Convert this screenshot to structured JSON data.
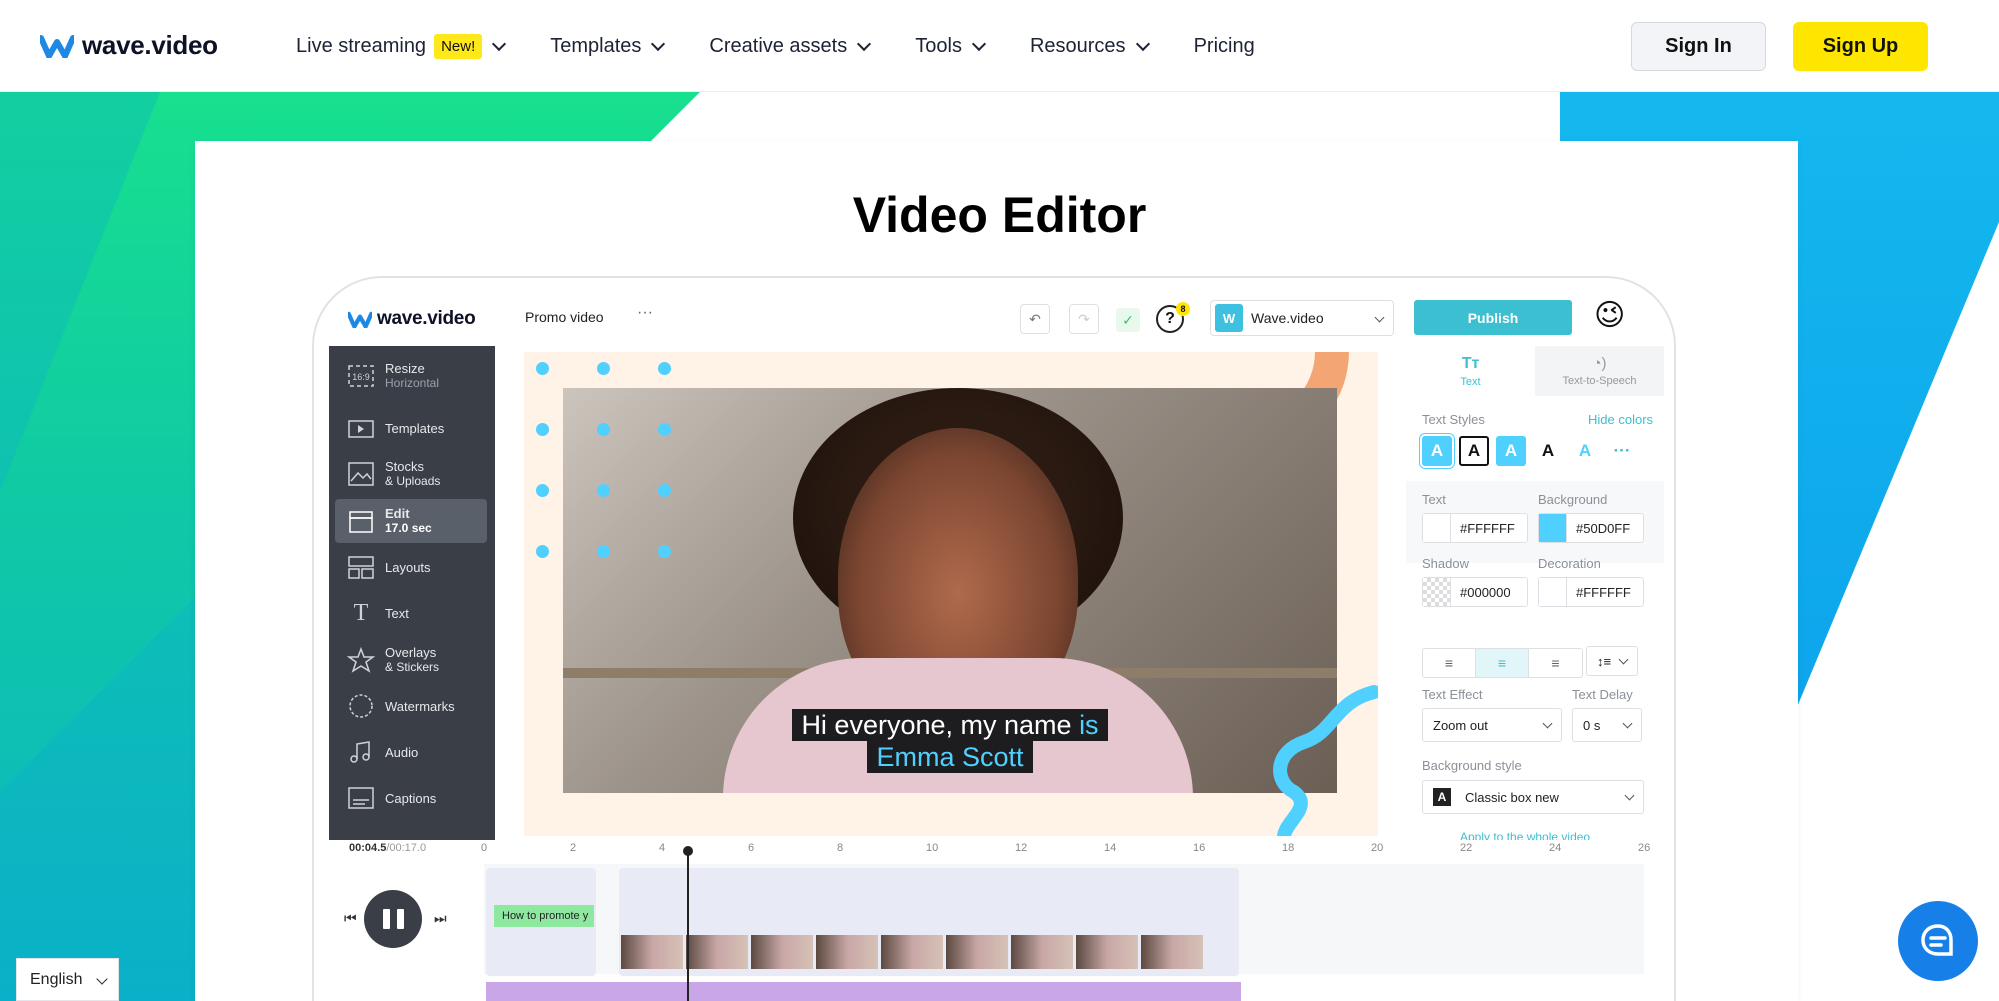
{
  "nav": {
    "brand": "wave.video",
    "items": [
      {
        "label": "Live streaming",
        "badge": "New!"
      },
      {
        "label": "Templates"
      },
      {
        "label": "Creative assets"
      },
      {
        "label": "Tools"
      },
      {
        "label": "Resources"
      },
      {
        "label": "Pricing"
      }
    ],
    "sign_in": "Sign In",
    "sign_up": "Sign Up"
  },
  "page": {
    "title": "Video Editor"
  },
  "app": {
    "brand": "wave.video",
    "project": "Promo video",
    "more": "···",
    "help_count": "8",
    "workspace": {
      "initial": "W",
      "name": "Wave.video"
    },
    "publish": "Publish",
    "sidebar": [
      {
        "icon": "16:9",
        "label": "Resize",
        "sub": "Horizontal"
      },
      {
        "icon": "templates-icon",
        "label": "Templates",
        "sub": ""
      },
      {
        "icon": "image-icon",
        "label": "Stocks",
        "sub": "& Uploads"
      },
      {
        "icon": "clapper-icon",
        "label": "Edit",
        "sub": "17.0 sec"
      },
      {
        "icon": "layouts-icon",
        "label": "Layouts",
        "sub": ""
      },
      {
        "icon": "T",
        "label": "Text",
        "sub": ""
      },
      {
        "icon": "star-icon",
        "label": "Overlays",
        "sub": "& Stickers"
      },
      {
        "icon": "watermark-icon",
        "label": "Watermarks",
        "sub": ""
      },
      {
        "icon": "music-icon",
        "label": "Audio",
        "sub": ""
      },
      {
        "icon": "captions-icon",
        "label": "Captions",
        "sub": ""
      }
    ],
    "caption": {
      "line1": "Hi everyone, my name",
      "line1_hl": "is",
      "line2": "Emma Scott"
    },
    "panel": {
      "tabs": [
        {
          "label": "Text"
        },
        {
          "label": "Text-to-Speech"
        }
      ],
      "text_styles": "Text Styles",
      "hide_colors": "Hide colors",
      "text_label": "Text",
      "text_value": "#FFFFFF",
      "background_label": "Background",
      "background_value": "#50D0FF",
      "shadow_label": "Shadow",
      "shadow_value": "#000000",
      "decoration_label": "Decoration",
      "decoration_value": "#FFFFFF",
      "effect_label": "Text Effect",
      "effect_value": "Zoom out",
      "delay_label": "Text Delay",
      "delay_value": "0 s",
      "bg_style_label": "Background style",
      "bg_style_value": "Classic box new",
      "apply": "Apply to the whole video"
    },
    "timeline": {
      "current": "00:04.5",
      "total": "/00:17.0",
      "ticks": [
        "0",
        "2",
        "4",
        "6",
        "8",
        "10",
        "12",
        "14",
        "16",
        "18",
        "20",
        "22",
        "24",
        "26"
      ],
      "clip_label": "How to promote y"
    }
  },
  "footer": {
    "language": "English"
  },
  "colors": {
    "accent": "#3cbfd0",
    "signup": "#ffe600",
    "highlight": "#50d0ff",
    "chat": "#1680e8"
  }
}
